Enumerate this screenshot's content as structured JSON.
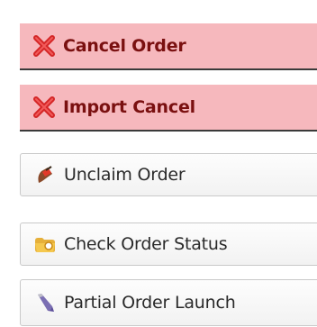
{
  "actions": [
    {
      "label": "Cancel Order",
      "icon": "red-x-icon",
      "style": "danger"
    },
    {
      "label": "Import Cancel",
      "icon": "red-x-icon",
      "style": "danger"
    },
    {
      "label": "Unclaim Order",
      "icon": "flag-pin-icon",
      "style": "normal"
    },
    {
      "label": "Check Order Status",
      "icon": "folder-status-icon",
      "style": "normal"
    },
    {
      "label": "Partial Order Launch",
      "icon": "pen-launch-icon",
      "style": "normal"
    }
  ],
  "colors": {
    "danger_bg": "#f6b8bd",
    "danger_text": "#7a1010",
    "icon_red": "#e03030"
  }
}
